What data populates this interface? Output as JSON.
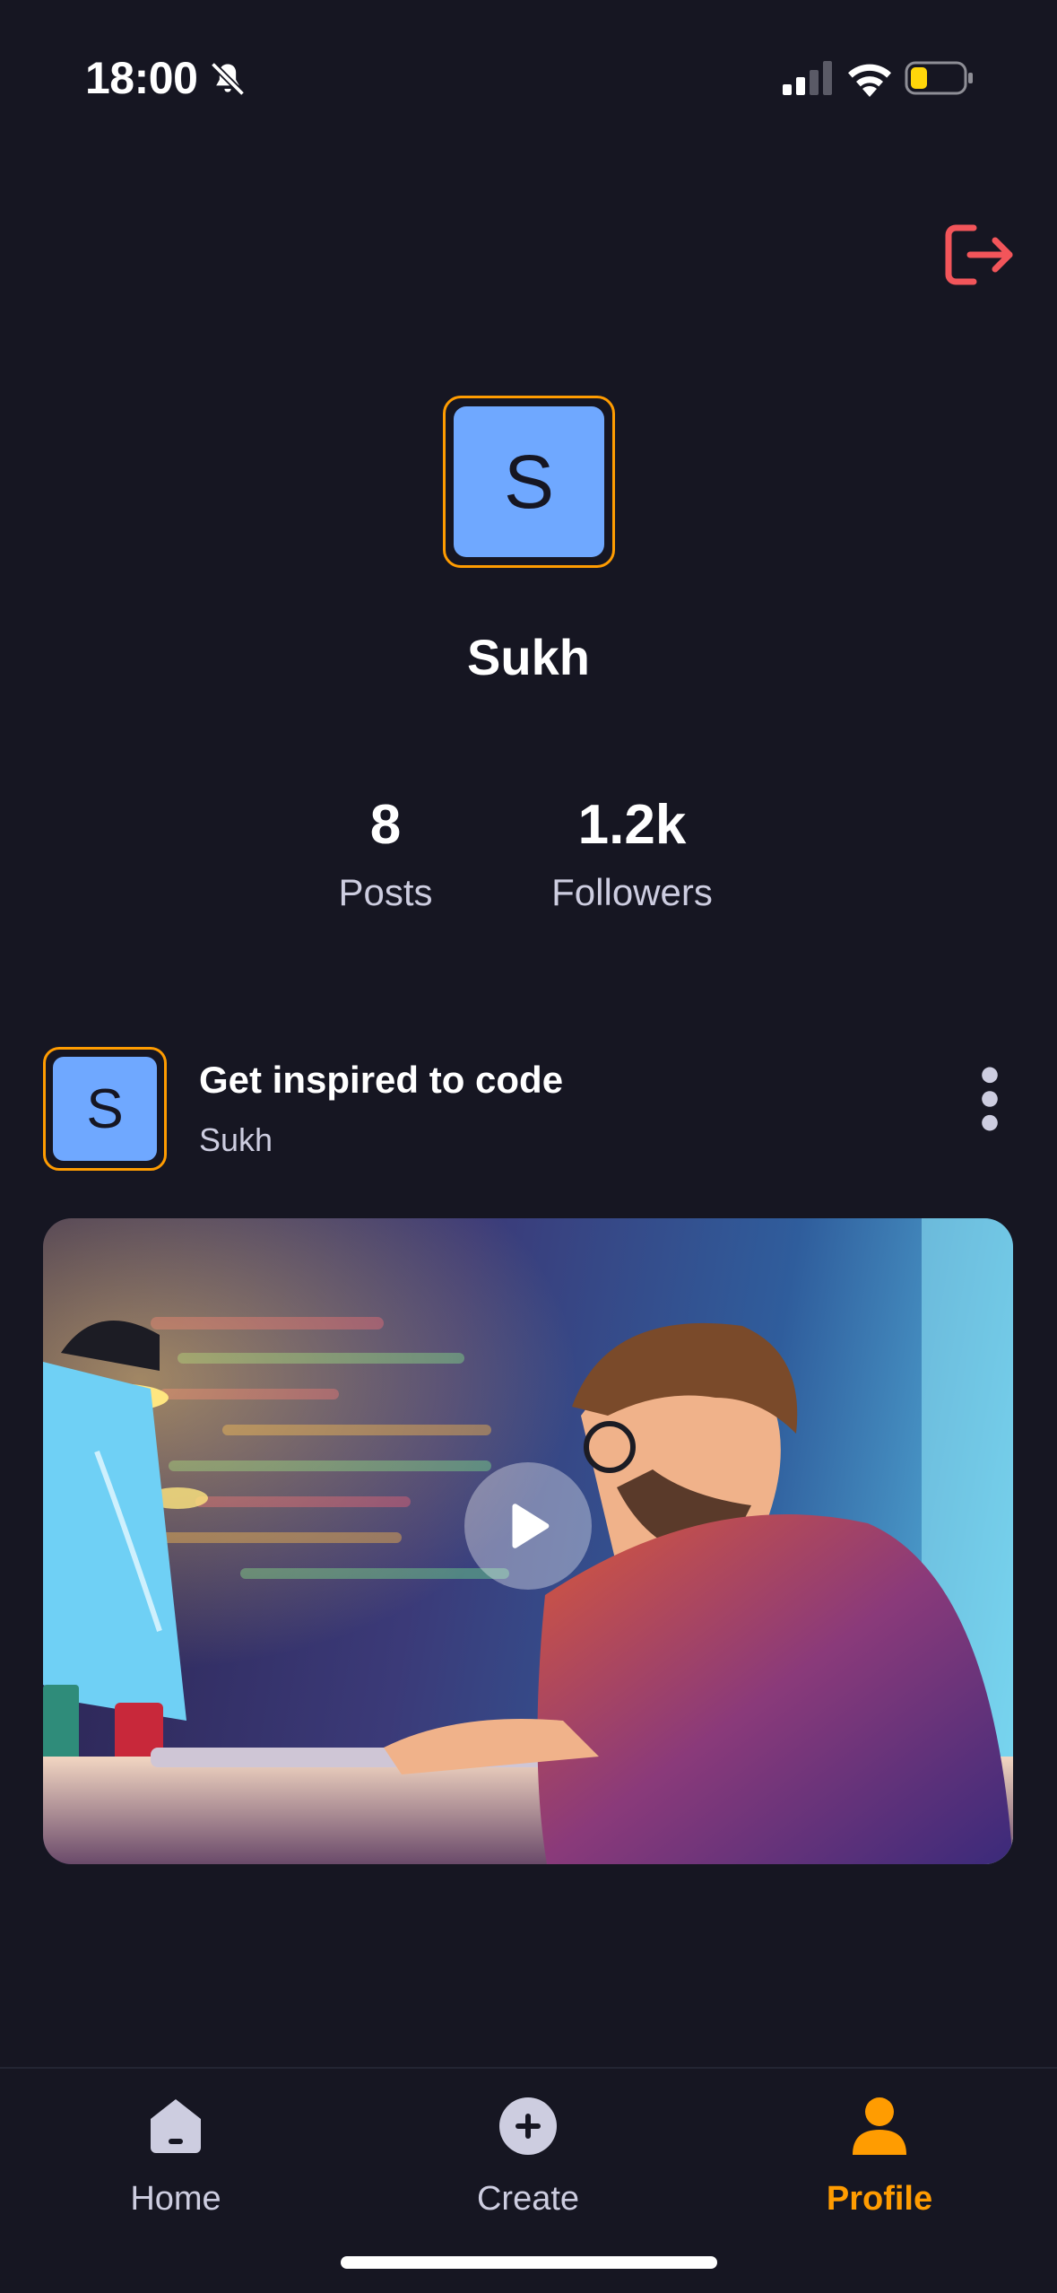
{
  "status_bar": {
    "time": "18:00",
    "icons": [
      "bell-off-icon",
      "signal-icon",
      "wifi-icon",
      "battery-icon"
    ],
    "battery_level": 0.3,
    "battery_color": "#FFD60A"
  },
  "header": {
    "logout_icon": "logout-icon",
    "logout_color": "#F2555A"
  },
  "profile": {
    "avatar_initial": "S",
    "name": "Sukh",
    "stats": {
      "posts_value": "8",
      "posts_label": "Posts",
      "followers_value": "1.2k",
      "followers_label": "Followers"
    }
  },
  "post": {
    "avatar_initial": "S",
    "title": "Get inspired to code",
    "author": "Sukh",
    "menu_icon": "more-vertical-icon",
    "thumbnail": "developer-coding-illustration",
    "play_icon": "play-icon"
  },
  "tabs": [
    {
      "label": "Home",
      "icon": "home-icon",
      "active": false
    },
    {
      "label": "Create",
      "icon": "plus-circle-icon",
      "active": false
    },
    {
      "label": "Profile",
      "icon": "profile-icon",
      "active": true
    }
  ],
  "colors": {
    "background": "#161622",
    "accent": "#FF9C01",
    "avatar": "#6FA8FF",
    "muted_text": "#CDCDE0"
  }
}
